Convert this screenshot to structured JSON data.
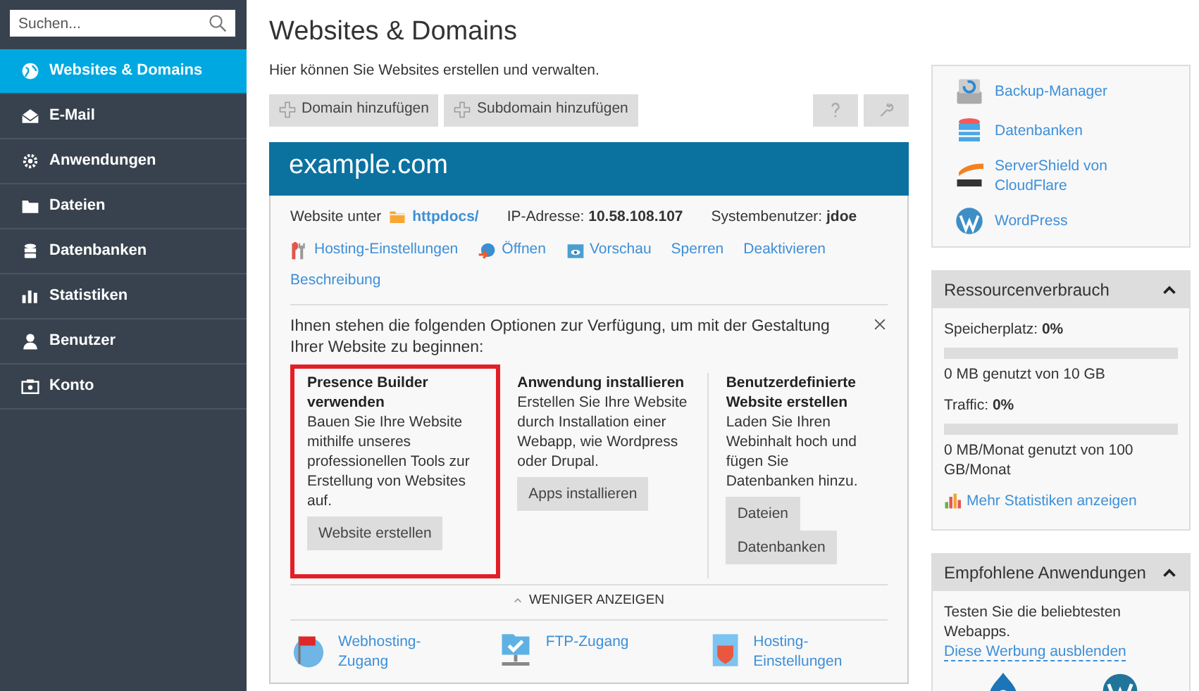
{
  "search": {
    "placeholder": "Suchen..."
  },
  "sidebar": {
    "items": [
      {
        "label": "Websites & Domains",
        "selected": true
      },
      {
        "label": "E-Mail",
        "selected": false
      },
      {
        "label": "Anwendungen",
        "selected": false
      },
      {
        "label": "Dateien",
        "selected": false
      },
      {
        "label": "Datenbanken",
        "selected": false
      },
      {
        "label": "Statistiken",
        "selected": false
      },
      {
        "label": "Benutzer",
        "selected": false
      },
      {
        "label": "Konto",
        "selected": false
      }
    ]
  },
  "page": {
    "title": "Websites & Domains",
    "description": "Hier können Sie Websites erstellen und verwalten."
  },
  "toolbar": {
    "buttons": [
      "Domain hinzufügen",
      "Subdomain hinzufügen"
    ]
  },
  "domain": {
    "name": "example.com",
    "website_label": "Website unter",
    "docroot": "httpdocs/",
    "ip": "IP-Adresse: **10.58.108.107**",
    "user": "Systembenutzer: **jdoe**",
    "actions": [
      "Hosting-Einstellungen",
      "Öffnen",
      "Vorschau",
      "Sperren",
      "Deaktivieren",
      "Beschreibung"
    ]
  },
  "intro": {
    "text": "Ihnen stehen die folgenden Optionen zur Verfügung, um mit der Gestaltung Ihrer Website zu beginnen:",
    "options": [
      {
        "title": "Presence Builder verwenden",
        "text": "Bauen Sie Ihre Website mithilfe unseres professionellen Tools zur Erstellung von Websites auf.",
        "highlighted": true,
        "buttons": [
          "Website erstellen"
        ]
      },
      {
        "title": "Anwendung installieren",
        "text": "Erstellen Sie Ihre Website durch Installation einer Webapp, wie Wordpress oder Drupal.",
        "highlighted": false,
        "buttons": [
          "Apps installieren"
        ]
      },
      {
        "title": "Benutzerdefinierte Website erstellen",
        "text": "Laden Sie Ihren Webinhalt hoch und fügen Sie Datenbanken hinzu.",
        "highlighted": false,
        "buttons": [
          "Dateien",
          "Datenbanken"
        ]
      }
    ],
    "toggle": "WENIGER ANZEIGEN",
    "expanded": true
  },
  "quick_links": [
    "Webhosting-Zugang",
    "FTP-Zugang",
    "Hosting-Einstellungen"
  ],
  "tools": [
    "Backup-Manager",
    "Datenbanken",
    "ServerShield von CloudFlare",
    "WordPress"
  ],
  "resources": {
    "title": "Ressourcenverbrauch",
    "expanded": true,
    "meters": [
      {
        "label": "Speicherplatz: **0%**",
        "level": 0,
        "reading": "0 MB genutzt von 10 GB"
      },
      {
        "label": "Traffic: **0%**",
        "level": 0,
        "reading": "0 MB/Monat genutzt von 100 GB/Monat"
      }
    ],
    "link": "Mehr Statistiken anzeigen"
  },
  "recommended": {
    "title": "Empfohlene Anwendungen",
    "expanded": true,
    "text": "Testen Sie die beliebtesten Webapps.",
    "link": "Diese Werbung ausblenden"
  }
}
